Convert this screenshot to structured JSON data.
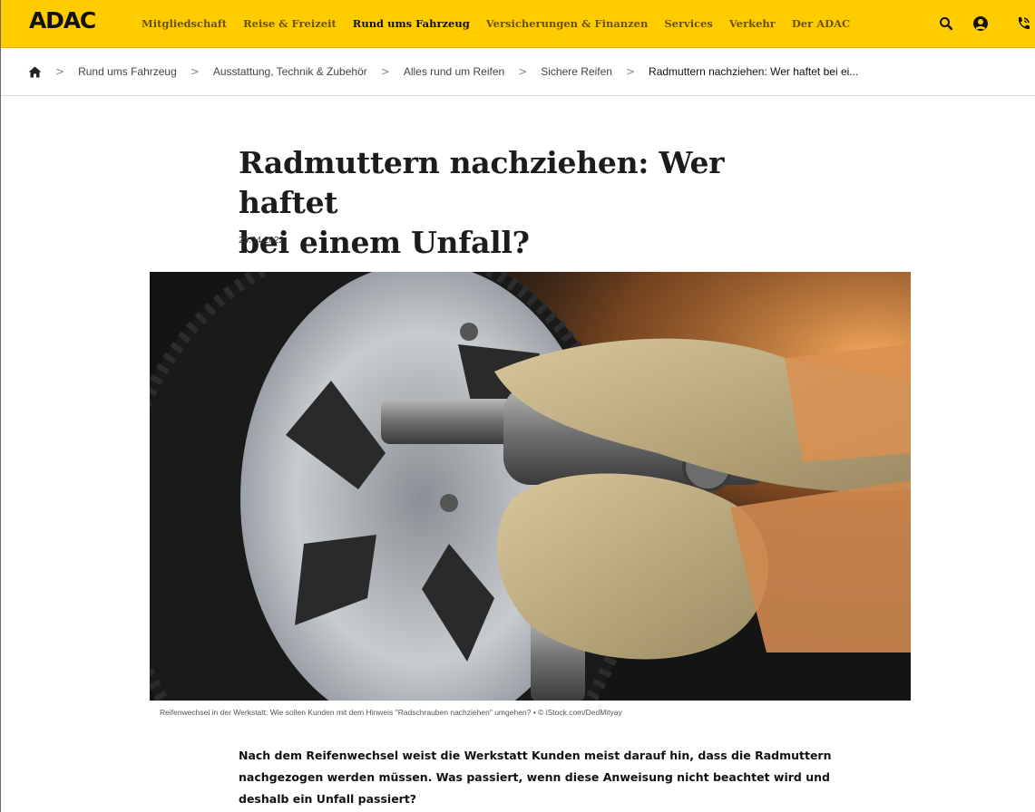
{
  "brand": {
    "logo": "ADAC"
  },
  "nav": {
    "items": [
      {
        "label": "Mitgliedschaft",
        "active": false
      },
      {
        "label": "Reise & Freizeit",
        "active": false
      },
      {
        "label": "Rund ums Fahrzeug",
        "active": true
      },
      {
        "label": "Versicherungen & Finanzen",
        "active": false
      },
      {
        "label": "Services",
        "active": false
      },
      {
        "label": "Verkehr",
        "active": false
      },
      {
        "label": "Der ADAC",
        "active": false
      }
    ]
  },
  "header_icons": [
    "search-icon",
    "account-icon",
    "phone-icon"
  ],
  "breadcrumb": {
    "items": [
      "Rund ums Fahrzeug",
      "Ausstattung, Technik & Zubehör",
      "Alles rund um Reifen",
      "Sichere Reifen",
      "Radmuttern nachziehen: Wer haftet bei ei..."
    ]
  },
  "article": {
    "title_line1": "Radmuttern nachziehen: Wer haftet",
    "title_line2": "bei einem Unfall?",
    "date": "25.04.2022",
    "caption": "Reifenwechsel in der Werkstatt: Wie sollen Kunden mit dem Hinweis \"Radschrauben nachziehen\" umgehen? • © iStock.com/DedMityay",
    "lead_lines": [
      "Nach dem Reifenwechsel weist die Werkstatt Kunden meist darauf hin, dass die Radmuttern",
      "nachgezogen werden müssen. Was passiert, wenn diese Anweisung nicht beachtet wird und",
      "deshalb ein Unfall passiert?"
    ]
  },
  "colors": {
    "brand_yellow": "#ffcc00",
    "text_dark": "#111111"
  }
}
